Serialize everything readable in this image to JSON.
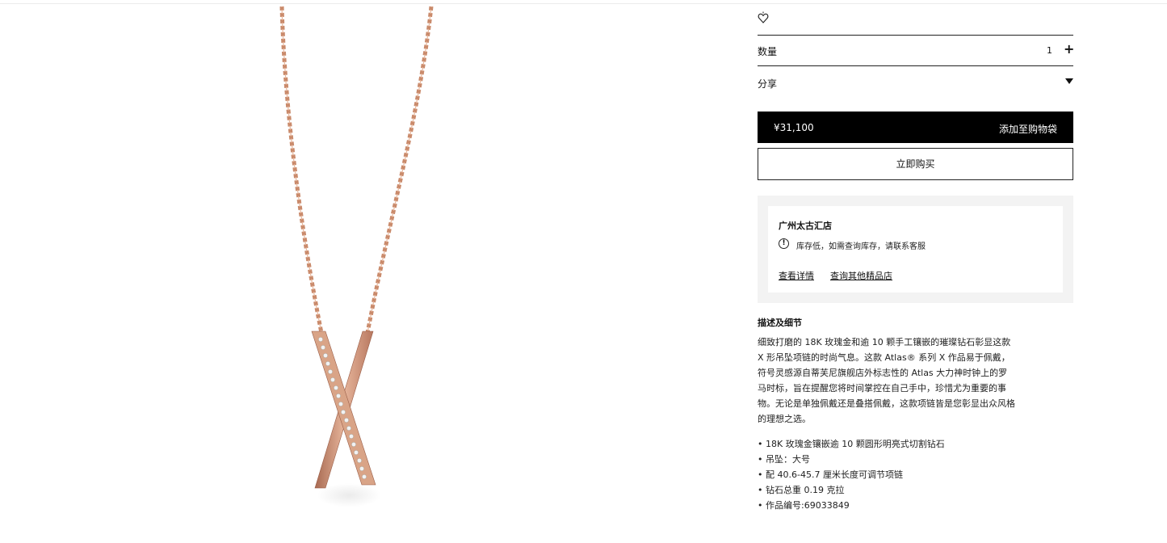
{
  "quantity": {
    "label": "数量",
    "value": "1",
    "increment_symbol": "+"
  },
  "share": {
    "label": "分享"
  },
  "cart": {
    "price": "¥31,100",
    "add_label": "添加至购物袋"
  },
  "buy_now": {
    "label": "立即购买"
  },
  "store": {
    "name": "广州太古汇店",
    "info_symbol": "!",
    "stock_message": "库存低，如需查询库存，请联系客服",
    "details_link": "查看详情",
    "other_stores_link": "查询其他精品店"
  },
  "description": {
    "title": "描述及细节",
    "body": "细致打磨的 18K 玫瑰金和逾 10 颗手工镶嵌的璀璨钻石彰显这款 X 形吊坠项链的时尚气息。这款 Atlas® 系列 X 作品易于佩戴，符号灵感源自蒂芙尼旗舰店外标志性的 Atlas 大力神时钟上的罗马时标，旨在提醒您将时间掌控在自己手中，珍惜尤为重要的事物。无论是单独佩戴还是叠搭佩戴，这款项链皆是您彰显出众风格的理想之选。",
    "specs": [
      "18K 玫瑰金镶嵌逾 10 颗圆形明亮式切割钻石",
      "吊坠：大号",
      "配 40.6-45.7 厘米长度可调节项链",
      "钻石总重 0.19 克拉",
      "作品编号:69033849"
    ]
  },
  "colors": {
    "rose_gold": "#c98a6b",
    "button_black": "#000000",
    "store_bg": "#f3f3f3"
  },
  "icons": [
    "heart-icon",
    "plus-icon",
    "chevron-down-icon",
    "info-icon"
  ]
}
